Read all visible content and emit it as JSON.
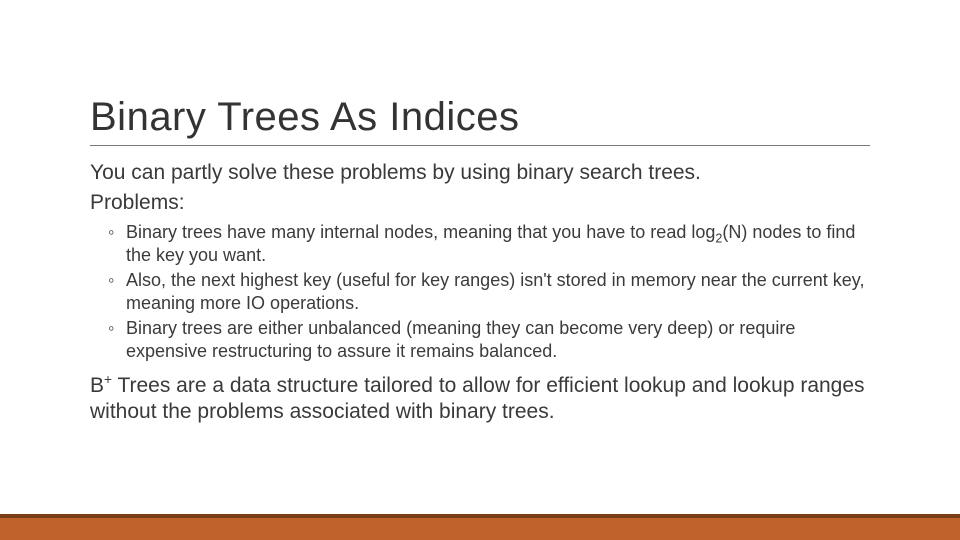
{
  "title": "Binary Trees As Indices",
  "intro": "You can partly solve these problems by using binary search trees.",
  "problems_label": "Problems:",
  "bullets": {
    "b1_pre": "Binary trees have many internal nodes, meaning that you have to read log",
    "b1_sub": "2",
    "b1_post": "(N) nodes to find the key you want.",
    "b2": "Also, the next highest key (useful for key ranges) isn't stored in memory near the current key, meaning more IO operations.",
    "b3": "Binary trees are either unbalanced (meaning they can become very deep) or require expensive restructuring to assure it remains balanced."
  },
  "closing_pre": "B",
  "closing_sup": "+",
  "closing_post": " Trees are a data structure tailored to allow for efficient lookup and lookup ranges without the problems associated with binary trees."
}
